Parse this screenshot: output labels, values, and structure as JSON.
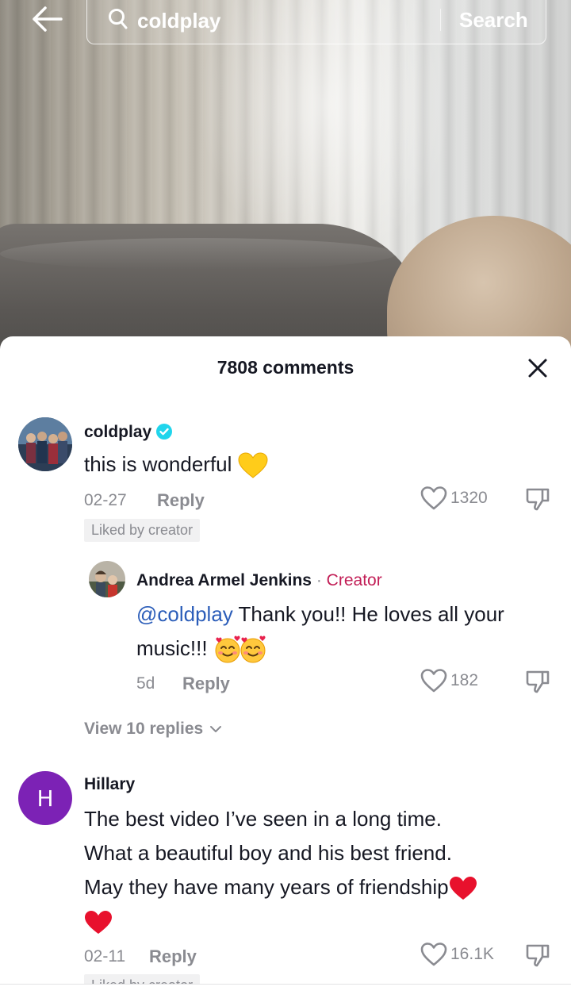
{
  "search": {
    "query": "coldplay",
    "button_label": "Search"
  },
  "sheet": {
    "title": "7808 comments"
  },
  "comments": [
    {
      "username": "coldplay",
      "verified": true,
      "text": "this is wonderful",
      "emoji": "yellow-heart",
      "date": "02-27",
      "reply_label": "Reply",
      "likes": "1320",
      "liked_by_creator": "Liked by creator",
      "replies": [
        {
          "username": "Andrea Armel Jenkins",
          "separator": "·",
          "role": "Creator",
          "mention": "@coldplay",
          "text_line1": " Thank you!! He loves all your",
          "text_line2": "music!!!",
          "emoji": "smiling-face-with-hearts x2",
          "date": "5d",
          "reply_label": "Reply",
          "likes": "182"
        }
      ],
      "view_replies": "View 10 replies"
    },
    {
      "avatar_letter": "H",
      "avatar_color": "#7c22b5",
      "username": "Hillary",
      "text_line1": "The best video I’ve seen in a long time.",
      "text_line2": "What a beautiful boy and his best friend.",
      "text_line3": "May they have many years of friendship",
      "emoji": "red-heart",
      "date": "02-11",
      "reply_label": "Reply",
      "likes": "16.1K",
      "liked_by_creator": "Liked by creator"
    }
  ],
  "colors": {
    "text": "#161823",
    "muted": "#8a8b91",
    "mention": "#2b5db9",
    "creator_tag": "#c21e56",
    "verified": "#20d5ec"
  }
}
